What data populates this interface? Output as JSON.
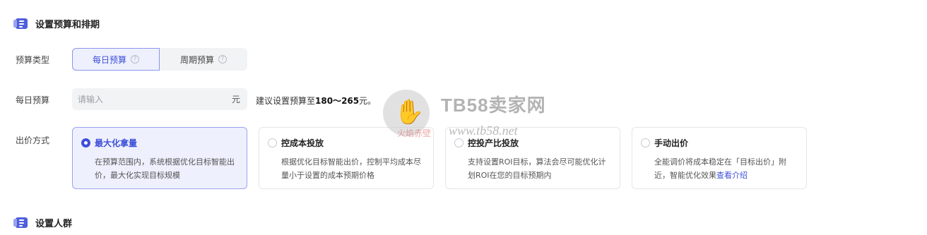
{
  "sections": {
    "budget_schedule": {
      "title": "设置预算和排期"
    },
    "audience": {
      "title": "设置人群"
    }
  },
  "budget_type": {
    "label": "预算类型",
    "options": [
      {
        "label": "每日预算",
        "selected": true
      },
      {
        "label": "周期预算",
        "selected": false
      }
    ],
    "help_icon": "?"
  },
  "daily_budget": {
    "label": "每日预算",
    "placeholder": "请输入",
    "unit": "元",
    "suggestion_prefix": "建议设置预算至",
    "suggestion_range": "180～265",
    "suggestion_suffix": "元。"
  },
  "bid_method": {
    "label": "出价方式",
    "cards": [
      {
        "title": "最大化拿量",
        "desc": "在预算范围内，系统根据优化目标智能出价，最大化实现目标规模",
        "selected": true
      },
      {
        "title": "控成本投放",
        "desc": "根据优化目标智能出价，控制平均成本尽量小于设置的成本预期价格",
        "selected": false
      },
      {
        "title": "控投产比投放",
        "desc": "支持设置ROI目标，算法会尽可能优化计划ROI在您的目标预期内",
        "selected": false
      },
      {
        "title": "手动出价",
        "desc": "全能调价将成本稳定在「目标出价」附近，智能优化效果",
        "link": "查看介绍",
        "selected": false
      }
    ]
  },
  "watermark": {
    "title": "TB58卖家网",
    "url": "www.tb58.net",
    "sub": "火焰赤壁"
  },
  "colors": {
    "accent": "#3d4fd8",
    "selected_bg": "#eef0fd",
    "input_bg": "#f2f3f5"
  }
}
